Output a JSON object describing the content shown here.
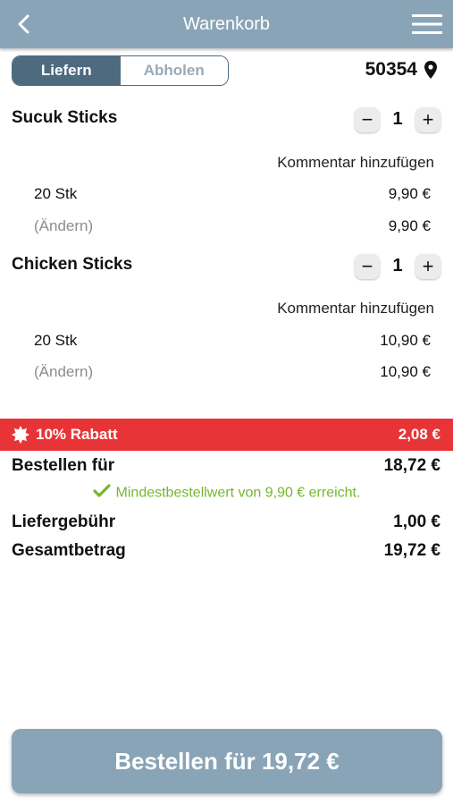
{
  "header": {
    "title": "Warenkorb",
    "back_icon": "chevron-left-icon",
    "menu_icon": "hamburger-menu-icon"
  },
  "mode_toggle": {
    "deliver_label": "Liefern",
    "pickup_label": "Abholen",
    "selected": "Liefern"
  },
  "location": {
    "zip": "50354",
    "icon": "map-pin-icon"
  },
  "items": [
    {
      "name": "Sucuk Sticks",
      "quantity": "1",
      "minus": "−",
      "plus": "+",
      "comment_label": "Kommentar hinzufügen",
      "variant": "20 Stk",
      "variant_price": "9,90 €",
      "change_label": "(Ändern)",
      "total_price": "9,90 €"
    },
    {
      "name": "Chicken Sticks",
      "quantity": "1",
      "minus": "−",
      "plus": "+",
      "comment_label": "Kommentar hinzufügen",
      "variant": "20 Stk",
      "variant_price": "10,90 €",
      "change_label": "(Ändern)",
      "total_price": "10,90 €"
    }
  ],
  "discount": {
    "label": "10% Rabatt",
    "amount": "2,08 €",
    "color": "#e83437"
  },
  "summary": {
    "order_for_label": "Bestellen für",
    "order_for_value": "18,72 €",
    "minimum_text": "Mindestbestellwert von 9,90 € erreicht.",
    "delivery_fee_label": "Liefergebühr",
    "delivery_fee_value": "1,00 €",
    "total_label": "Gesamtbetrag",
    "total_value": "19,72 €"
  },
  "order_button": {
    "label": "Bestellen für 19,72 €"
  },
  "colors": {
    "header": "#8aa4b7",
    "toggle_active": "#4e6a7f",
    "success": "#74b72f"
  }
}
